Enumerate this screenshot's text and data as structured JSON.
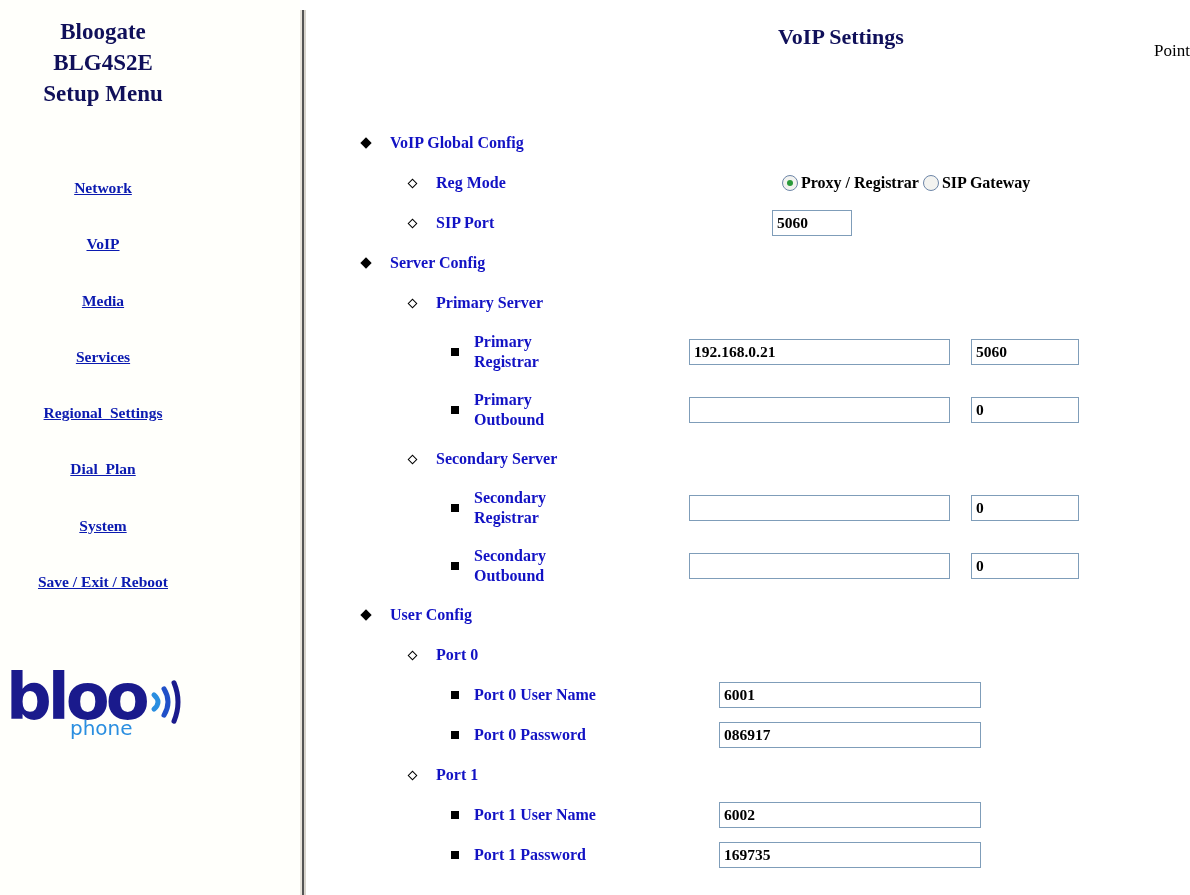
{
  "sidebar": {
    "title_lines": [
      "Bloogate",
      "BLG4S2E",
      "Setup Menu"
    ],
    "items": [
      {
        "label": "Network"
      },
      {
        "label": "VoIP"
      },
      {
        "label": "Media"
      },
      {
        "label": "Services"
      },
      {
        "label": "Regional  Settings"
      },
      {
        "label": "Dial  Plan"
      },
      {
        "label": "System"
      },
      {
        "label": "Save / Exit / Reboot"
      }
    ],
    "logo": {
      "text": "bloo",
      "subtext": "phone"
    }
  },
  "page": {
    "title": "VoIP Settings",
    "corner_text": "Point"
  },
  "sections": [
    {
      "label": "VoIP Global Config",
      "children": [
        {
          "label": "Reg Mode",
          "kind": "radio",
          "options": [
            {
              "label": "Proxy / Registrar",
              "selected": true
            },
            {
              "label": "SIP Gateway",
              "selected": false
            }
          ]
        },
        {
          "label": "SIP Port",
          "kind": "field",
          "value": "5060"
        }
      ]
    },
    {
      "label": "Server Config",
      "children": [
        {
          "label": "Primary Server",
          "kind": "group",
          "children": [
            {
              "label": "Primary Registrar",
              "kind": "pair",
              "address": "192.168.0.21",
              "port": "5060"
            },
            {
              "label": "Primary Outbound",
              "kind": "pair",
              "port": "0"
            }
          ]
        },
        {
          "label": "Secondary Server",
          "kind": "group",
          "children": [
            {
              "label": "Secondary Registrar",
              "kind": "pair",
              "port": "0"
            },
            {
              "label": "Secondary Outbound",
              "kind": "pair",
              "port": "0"
            }
          ]
        }
      ]
    },
    {
      "label": "User Config",
      "children": [
        {
          "label": "Port 0",
          "kind": "group",
          "children": [
            {
              "label": "Port 0 User Name",
              "kind": "field",
              "value": "6001"
            },
            {
              "label": "Port 0 Password",
              "kind": "field",
              "value": "086917"
            }
          ]
        },
        {
          "label": "Port 1",
          "kind": "group",
          "children": [
            {
              "label": "Port 1 User Name",
              "kind": "field",
              "value": "6002"
            },
            {
              "label": "Port 1 Password",
              "kind": "field",
              "value": "169735"
            }
          ]
        }
      ]
    }
  ]
}
